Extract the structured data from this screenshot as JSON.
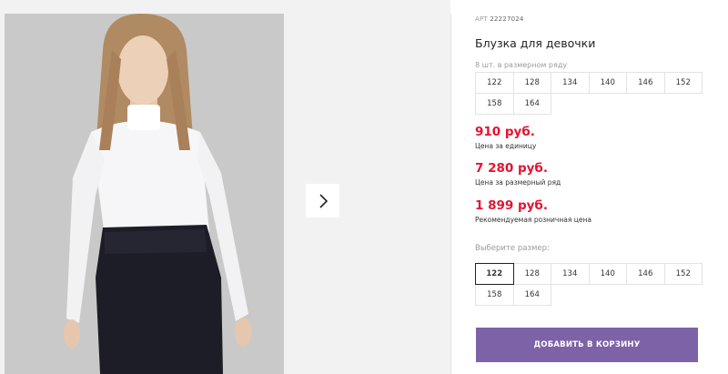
{
  "product": {
    "art_label": "АРТ",
    "art_number": "22227024",
    "title": "Блузка для девочки"
  },
  "pack_sizes": {
    "label": "8 шт. в размерном ряду",
    "sizes": [
      "122",
      "128",
      "134",
      "140",
      "146",
      "152",
      "158",
      "164"
    ]
  },
  "prices": [
    {
      "value": "910 руб.",
      "caption": "Цена за единицу"
    },
    {
      "value": "7 280 руб.",
      "caption": "Цена за размерный ряд"
    },
    {
      "value": "1 899 руб.",
      "caption": "Рекомендуемая розничная цена"
    }
  ],
  "size_picker": {
    "label": "Выберите размер:",
    "sizes": [
      "122",
      "128",
      "134",
      "140",
      "146",
      "152",
      "158",
      "164"
    ],
    "selected": "122"
  },
  "cart_button": {
    "label": "ДОБАВИТЬ В КОРЗИНУ"
  },
  "gallery": {
    "next_icon": "chevron-right-icon"
  },
  "colors": {
    "price": "#e5132f",
    "accent_button": "#7d62a8",
    "selected_border": "#222222"
  }
}
